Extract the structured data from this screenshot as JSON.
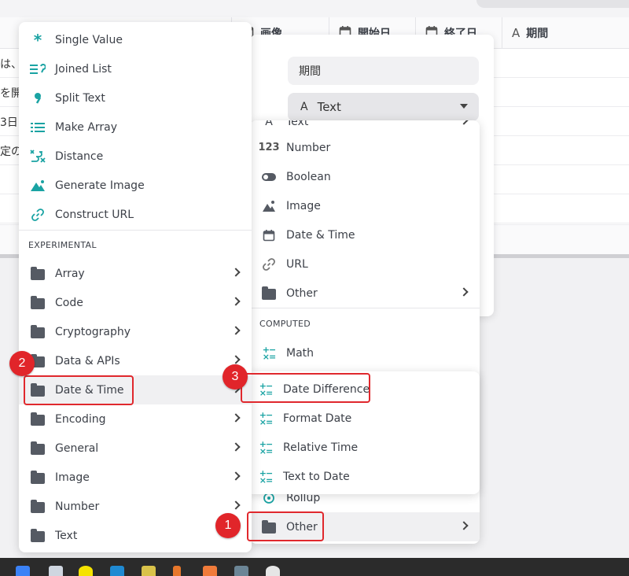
{
  "table": {
    "columns": [
      {
        "icon": "calendar-icon",
        "label": "画像"
      },
      {
        "icon": "calendar-icon",
        "label": "開始日"
      },
      {
        "icon": "calendar-icon",
        "label": "終了日"
      },
      {
        "icon": "text-a-icon",
        "label": "期間"
      }
    ],
    "row_fragments": [
      "は、",
      "を開",
      "3日",
      "定の"
    ]
  },
  "field_panel": {
    "name_value": "期間",
    "type_icon": "A",
    "type_value": "Text"
  },
  "menu_left": {
    "items": [
      {
        "icon": "asterisk-icon",
        "label": "Single Value"
      },
      {
        "icon": "joined-list-icon",
        "label": "Joined List"
      },
      {
        "icon": "split-text-icon",
        "label": "Split Text"
      },
      {
        "icon": "make-array-icon",
        "label": "Make Array"
      },
      {
        "icon": "distance-icon",
        "label": "Distance"
      },
      {
        "icon": "generate-image-icon",
        "label": "Generate Image"
      },
      {
        "icon": "link-icon",
        "label": "Construct URL"
      }
    ],
    "section_label": "EXPERIMENTAL",
    "folders": [
      {
        "label": "Array"
      },
      {
        "label": "Code"
      },
      {
        "label": "Cryptography"
      },
      {
        "label": "Data & APIs"
      },
      {
        "label": "Date & Time"
      },
      {
        "label": "Encoding"
      },
      {
        "label": "General"
      },
      {
        "label": "Image"
      },
      {
        "label": "Number"
      },
      {
        "label": "Text"
      }
    ]
  },
  "menu_types": {
    "partial_top_label": "Text",
    "items": [
      {
        "icon": "number-icon",
        "icon_text": "123",
        "label": "Number"
      },
      {
        "icon": "toggle-icon",
        "label": "Boolean"
      },
      {
        "icon": "image-icon",
        "label": "Image"
      },
      {
        "icon": "calendar-icon",
        "label": "Date & Time"
      },
      {
        "icon": "link-icon",
        "label": "URL"
      },
      {
        "icon": "folder-icon",
        "label": "Other"
      }
    ],
    "computed_label": "COMPUTED",
    "computed_items": [
      {
        "icon": "math-icon",
        "label": "Math"
      }
    ],
    "bottom_items": [
      {
        "icon": "rollup-icon",
        "label": "Rollup"
      },
      {
        "icon": "folder-icon",
        "label": "Other"
      }
    ]
  },
  "menu_datetime": {
    "items": [
      {
        "icon": "math-icon",
        "label": "Date Difference"
      },
      {
        "icon": "math-icon",
        "label": "Format Date"
      },
      {
        "icon": "math-icon",
        "label": "Relative Time"
      },
      {
        "icon": "math-icon",
        "label": "Text to Date"
      }
    ]
  },
  "annotations": {
    "step1": "1",
    "step2": "2",
    "step3": "3",
    "color": "#e1252a"
  },
  "colors": {
    "accent_teal": "#1aa3a3",
    "folder": "#555a63",
    "text": "#3c4048"
  }
}
